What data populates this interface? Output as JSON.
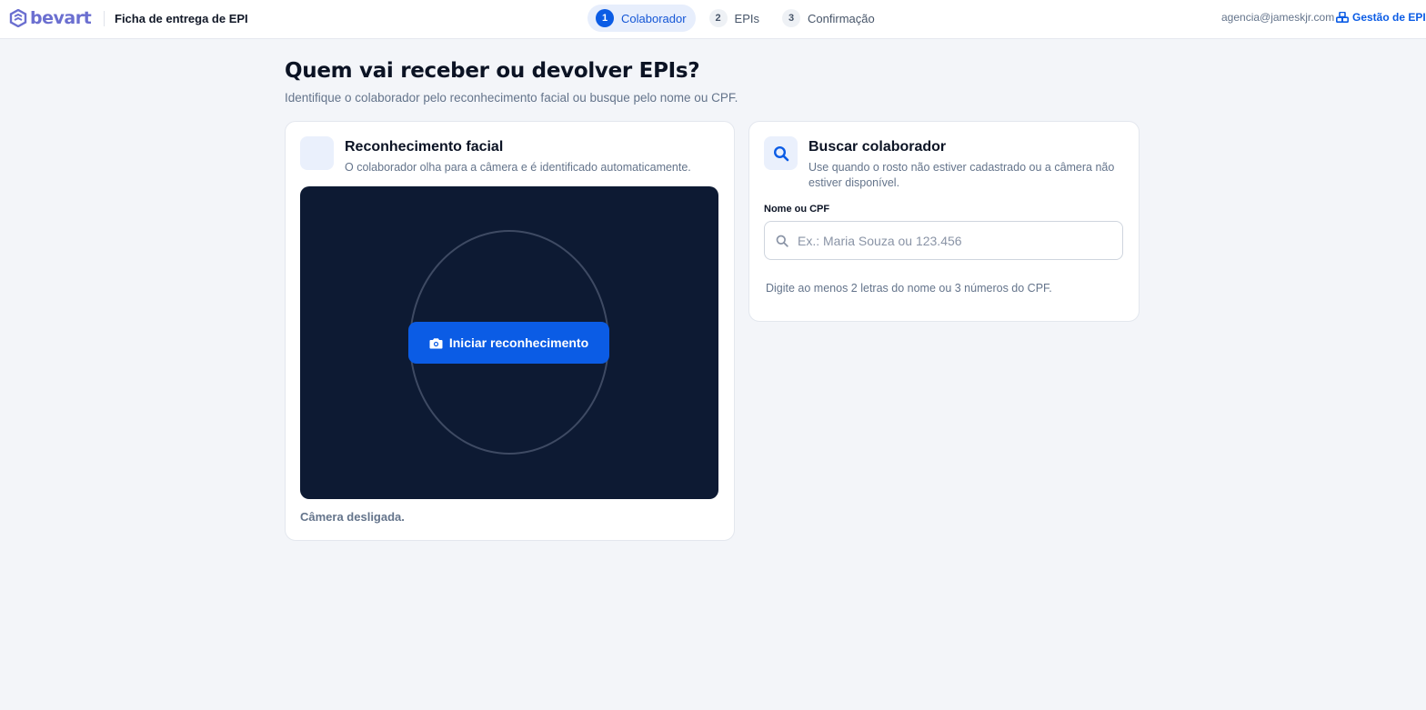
{
  "header": {
    "logo_text": "bevart",
    "app_title": "Ficha de entrega de EPI",
    "steps": [
      {
        "number": "1",
        "label": "Colaborador",
        "active": true
      },
      {
        "number": "2",
        "label": "EPIs",
        "active": false
      },
      {
        "number": "3",
        "label": "Confirmação",
        "active": false
      }
    ],
    "user_email": "agencia@jameskjr.com",
    "management_link": "Gestão de EPI"
  },
  "page": {
    "title": "Quem vai receber ou devolver EPIs?",
    "subtitle": "Identifique o colaborador pelo reconhecimento facial ou busque pelo nome ou CPF."
  },
  "face_card": {
    "title": "Reconhecimento facial",
    "description": "O colaborador olha para a câmera e é identificado automaticamente.",
    "start_button": "Iniciar reconhecimento",
    "camera_status": "Câmera desligada."
  },
  "search_card": {
    "title": "Buscar colaborador",
    "description": "Use quando o rosto não estiver cadastrado ou a câmera não estiver disponível.",
    "field_label": "Nome ou CPF",
    "field_placeholder": "Ex.: Maria Souza ou 123.456",
    "field_value": "",
    "hint": "Digite ao menos 2 letras do nome ou 3 números do CPF."
  },
  "colors": {
    "primary": "#0b5ce5",
    "logo": "#6b6fd0",
    "camera_bg": "#0d1a33",
    "page_bg": "#f3f5f9"
  }
}
